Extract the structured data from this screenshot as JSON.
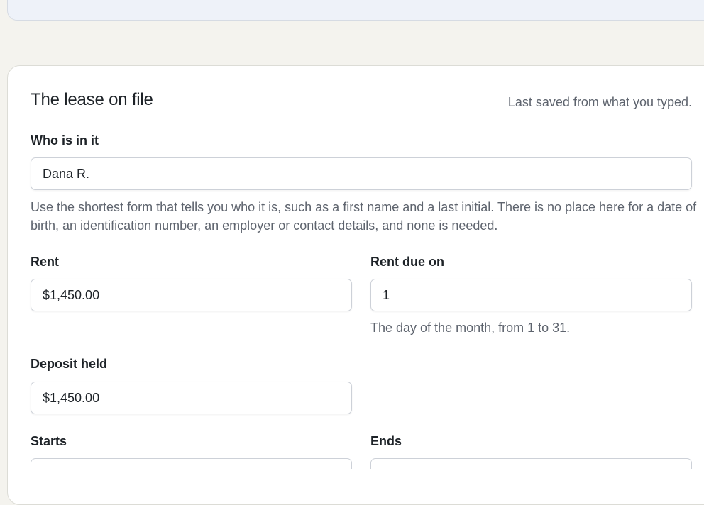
{
  "lease": {
    "title": "The lease on file",
    "saved_note": "Last saved from what you typed.",
    "occupant": {
      "label": "Who is in it",
      "value": "Dana R.",
      "hint": "Use the shortest form that tells you who it is, such as a first name and a last initial. There is no place here for a date of birth, an identification number, an employer or contact details, and none is needed."
    },
    "rent": {
      "label": "Rent",
      "value": "$1,450.00"
    },
    "rent_due": {
      "label": "Rent due on",
      "value": "1",
      "hint": "The day of the month, from 1 to 31."
    },
    "deposit": {
      "label": "Deposit held",
      "value": "$1,450.00"
    },
    "starts": {
      "label": "Starts"
    },
    "ends": {
      "label": "Ends"
    }
  }
}
